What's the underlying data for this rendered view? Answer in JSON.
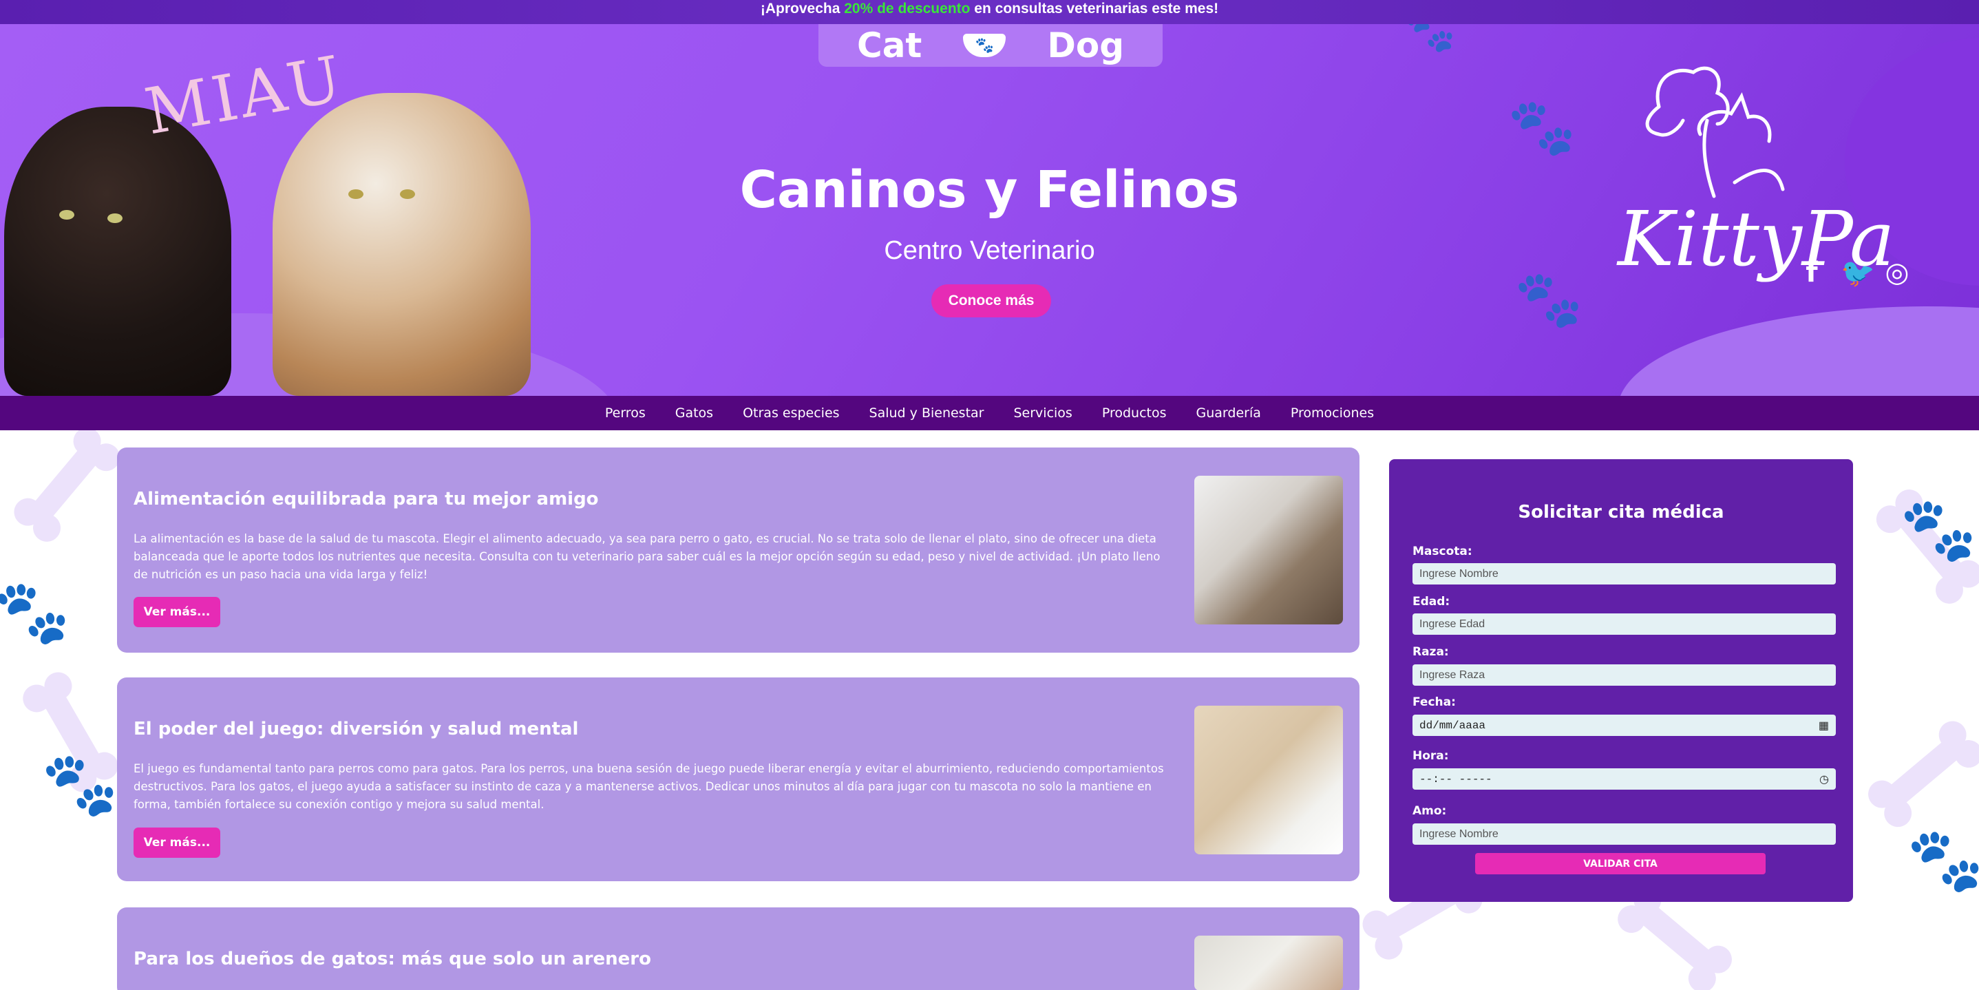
{
  "promo": {
    "prefix": "¡Aprovecha ",
    "highlight": "20% de descuento",
    "suffix": " en consultas veterinarias este mes!"
  },
  "hero": {
    "miau": "MIAU",
    "logo_left": "Cat",
    "logo_right": "Dog",
    "title": "Caninos y Felinos",
    "subtitle": "Centro Veterinario",
    "button": "Conoce más",
    "brand_name": "KittyPaw",
    "socials": [
      "facebook-icon",
      "twitter-icon",
      "instagram-icon"
    ]
  },
  "nav": {
    "items": [
      "Perros",
      "Gatos",
      "Otras especies",
      "Salud y Bienestar",
      "Servicios",
      "Productos",
      "Guardería",
      "Promociones"
    ]
  },
  "cards": [
    {
      "title": "Alimentación equilibrada para tu mejor amigo",
      "text": "La alimentación es la base de la salud de tu mascota. Elegir el alimento adecuado, ya sea para perro o gato, es crucial. No se trata solo de llenar el plato, sino de ofrecer una dieta balanceada que le aporte todos los nutrientes que necesita. Consulta con tu veterinario para saber cuál es la mejor opción según su edad, peso y nivel de actividad. ¡Un plato lleno de nutrición es un paso hacia una vida larga y feliz!",
      "button": "Ver más..."
    },
    {
      "title": "El poder del juego: diversión y salud mental",
      "text": "El juego es fundamental tanto para perros como para gatos. Para los perros, una buena sesión de juego puede liberar energía y evitar el aburrimiento, reduciendo comportamientos destructivos. Para los gatos, el juego ayuda a satisfacer su instinto de caza y a mantenerse activos. Dedicar unos minutos al día para jugar con tu mascota no solo la mantiene en forma, también fortalece su conexión contigo y mejora su salud mental.",
      "button": "Ver más..."
    },
    {
      "title": "Para los dueños de gatos: más que solo un arenero",
      "text": "",
      "button": ""
    }
  ],
  "form": {
    "title": "Solicitar cita médica",
    "fields": [
      {
        "label": "Mascota:",
        "placeholder": "Ingrese Nombre"
      },
      {
        "label": "Edad:",
        "placeholder": "Ingrese Edad"
      },
      {
        "label": "Raza:",
        "placeholder": "Ingrese Raza"
      },
      {
        "label": "Fecha:",
        "placeholder": "dd/mm/aaaa"
      },
      {
        "label": "Hora:",
        "placeholder": "--:-- -----"
      },
      {
        "label": "Amo:",
        "placeholder": "Ingrese Nombre"
      }
    ],
    "submit": "VALIDAR CITA"
  },
  "colors": {
    "accent": "#e62bb5",
    "nav": "#54067f",
    "panel": "#6120a8",
    "highlight": "#39e639"
  }
}
